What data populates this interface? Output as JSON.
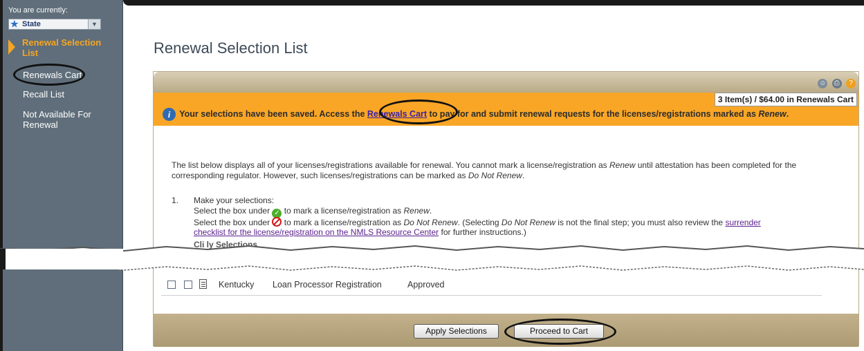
{
  "sidebar": {
    "currently_label": "You are currently:",
    "state_select": {
      "value": "State",
      "icon": "star-icon"
    },
    "items": [
      {
        "label": "Renewal Selection List",
        "active": true
      },
      {
        "label": "Renewals Cart"
      },
      {
        "label": "Recall List"
      },
      {
        "label": "Not Available For Renewal"
      }
    ]
  },
  "main": {
    "title": "Renewal Selection List",
    "header_icons": [
      "people-icon",
      "print-icon",
      "help-icon"
    ],
    "cart_summary": "3 Item(s) / $64.00 in Renewals Cart",
    "message": {
      "before": "Your selections have been saved. Access the ",
      "link": "Renewals Cart",
      "after": " to pay for and submit renewal requests for the licenses/registrations marked as ",
      "italic": "Renew",
      "end": "."
    },
    "intro": {
      "part1": "The list below displays all of your licenses/registrations available for renewal. You cannot mark a license/registration as ",
      "renew": "Renew",
      "part2": " until attestation has been completed for the corresponding regulator. However, such licenses/registrations can be marked as ",
      "do_not_renew": "Do Not Renew",
      "end": "."
    },
    "steps": {
      "number": "1.",
      "title": "Make your selections:",
      "line1_a": "Select the box under ",
      "line1_b": " to mark a license/registration as ",
      "line1_italic": "Renew",
      "line1_end": ".",
      "line2_a": "Select the box under ",
      "line2_b": " to mark a license/registration as ",
      "line2_italic": "Do Not Renew",
      "line2_c": ". (Selecting ",
      "line2_italic2": "Do Not Renew",
      "line2_d": " is not the final step; you must also review the ",
      "link_part1": "surrender",
      "link_part2": "checklist for the license/registration on the NMLS Resource Center",
      "line3_end": " for further instructions.)",
      "partial": "Cli        ly Selections"
    },
    "table_row": {
      "state": "Kentucky",
      "license": "Loan Processor Registration",
      "status": "Approved"
    },
    "buttons": {
      "apply": "Apply Selections",
      "proceed": "Proceed to Cart"
    },
    "colors": {
      "sidebar": "#5f6e7a",
      "accent": "#f5a623",
      "message_bar": "#f9a626",
      "panel_footer": "#b8a67f"
    }
  }
}
